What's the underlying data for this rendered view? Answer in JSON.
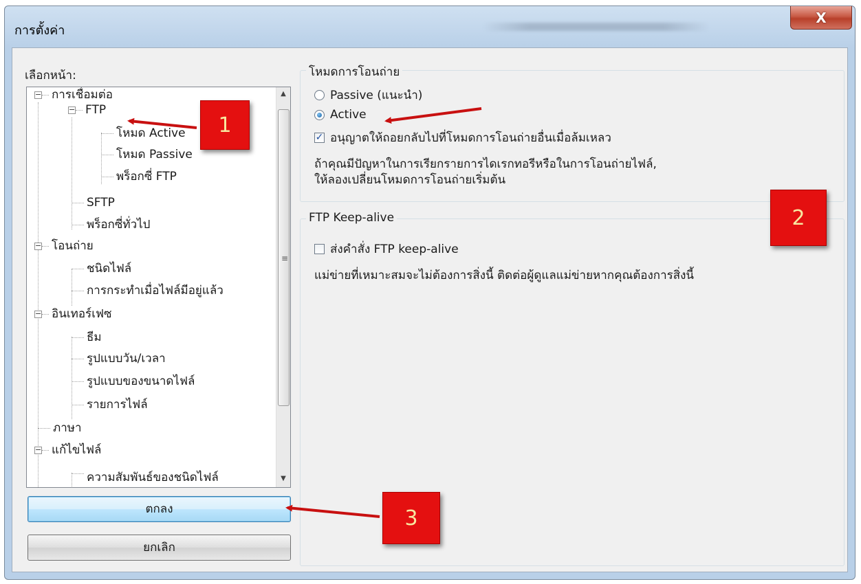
{
  "window": {
    "title": "การตั้งค่า",
    "close_label": "X"
  },
  "left": {
    "page_label": "เลือกหน้า:",
    "tree": [
      {
        "label": "การเชื่อมต่อ",
        "expander": "−"
      },
      {
        "label": "FTP",
        "expander": "−"
      },
      {
        "label": "โหมด Active"
      },
      {
        "label": "โหมด Passive"
      },
      {
        "label": "พร็อกซี่ FTP"
      },
      {
        "label": "SFTP"
      },
      {
        "label": "พร็อกซี่ทั่วไป"
      },
      {
        "label": "โอนถ่าย",
        "expander": "−"
      },
      {
        "label": "ชนิดไฟล์"
      },
      {
        "label": "การกระทำเมื่อไฟล์มีอยู่แล้ว"
      },
      {
        "label": "อินเทอร์เฟซ",
        "expander": "−"
      },
      {
        "label": "ธีม"
      },
      {
        "label": "รูปแบบวัน/เวลา"
      },
      {
        "label": "รูปแบบของขนาดไฟล์"
      },
      {
        "label": "รายการไฟล์"
      },
      {
        "label": "ภาษา"
      },
      {
        "label": "แก้ไขไฟล์",
        "expander": "−"
      },
      {
        "label": "ความสัมพันธ์ของชนิดไฟล์"
      }
    ],
    "scroll_up": "▲",
    "scroll_down": "▼",
    "scroll_grip": "≡",
    "ok_label": "ตกลง",
    "cancel_label": "ยกเลิก"
  },
  "transfer_mode": {
    "legend": "โหมดการโอนถ่าย",
    "passive_label": "Passive (แนะนำ)",
    "active_label": "Active",
    "selected": "Active",
    "fallback_label": "อนุญาตให้ถอยกลับไปที่โหมดการโอนถ่ายอื่นเมื่อล้มเหลว",
    "fallback_checked": true,
    "check_mark": "✓",
    "hint_line1": "ถ้าคุณมีปัญหาในการเรียกรายการไดเรกทอรีหรือในการโอนถ่ายไฟล์,",
    "hint_line2": "ให้ลองเปลี่ยนโหมดการโอนถ่ายเริ่มต้น"
  },
  "keepalive": {
    "legend": "FTP Keep-alive",
    "send_label": "ส่งคำสั่ง FTP keep-alive",
    "send_checked": false,
    "note": "แม่ข่ายที่เหมาะสมจะไม่ต้องการสิ่งนี้ ติดต่อผู้ดูแลแม่ข่ายหากคุณต้องการสิ่งนี้"
  },
  "annotations": {
    "marker1": "1",
    "marker2": "2",
    "marker3": "3",
    "marker_color": "#e41010"
  }
}
